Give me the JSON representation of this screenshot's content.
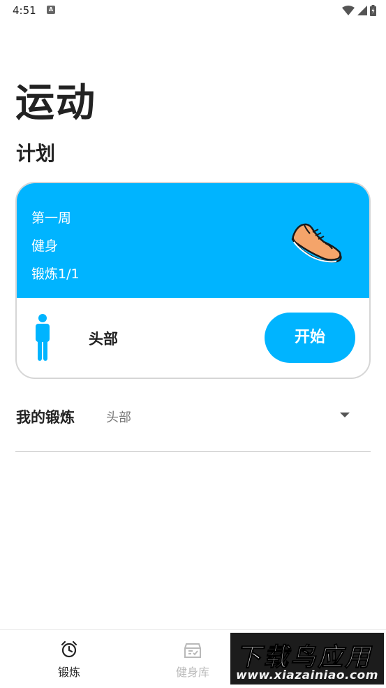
{
  "status_bar": {
    "time": "4:51",
    "notification_icon": "A"
  },
  "page": {
    "title": "运动",
    "section_title": "计划"
  },
  "plan_card": {
    "week": "第一周",
    "category": "健身",
    "progress": "锻炼1/1",
    "body_part": "头部",
    "start_label": "开始",
    "accent_color": "#00b4ff"
  },
  "my_training": {
    "label": "我的锻炼",
    "selected": "头部"
  },
  "bottom_nav": {
    "items": [
      {
        "label": "锻炼",
        "icon": "alarm-clock-icon",
        "active": true
      },
      {
        "label": "健身库",
        "icon": "library-box-icon",
        "active": false
      }
    ]
  },
  "watermark": {
    "main": "下载鸟应用",
    "url": "www.xiazainiao.com"
  }
}
